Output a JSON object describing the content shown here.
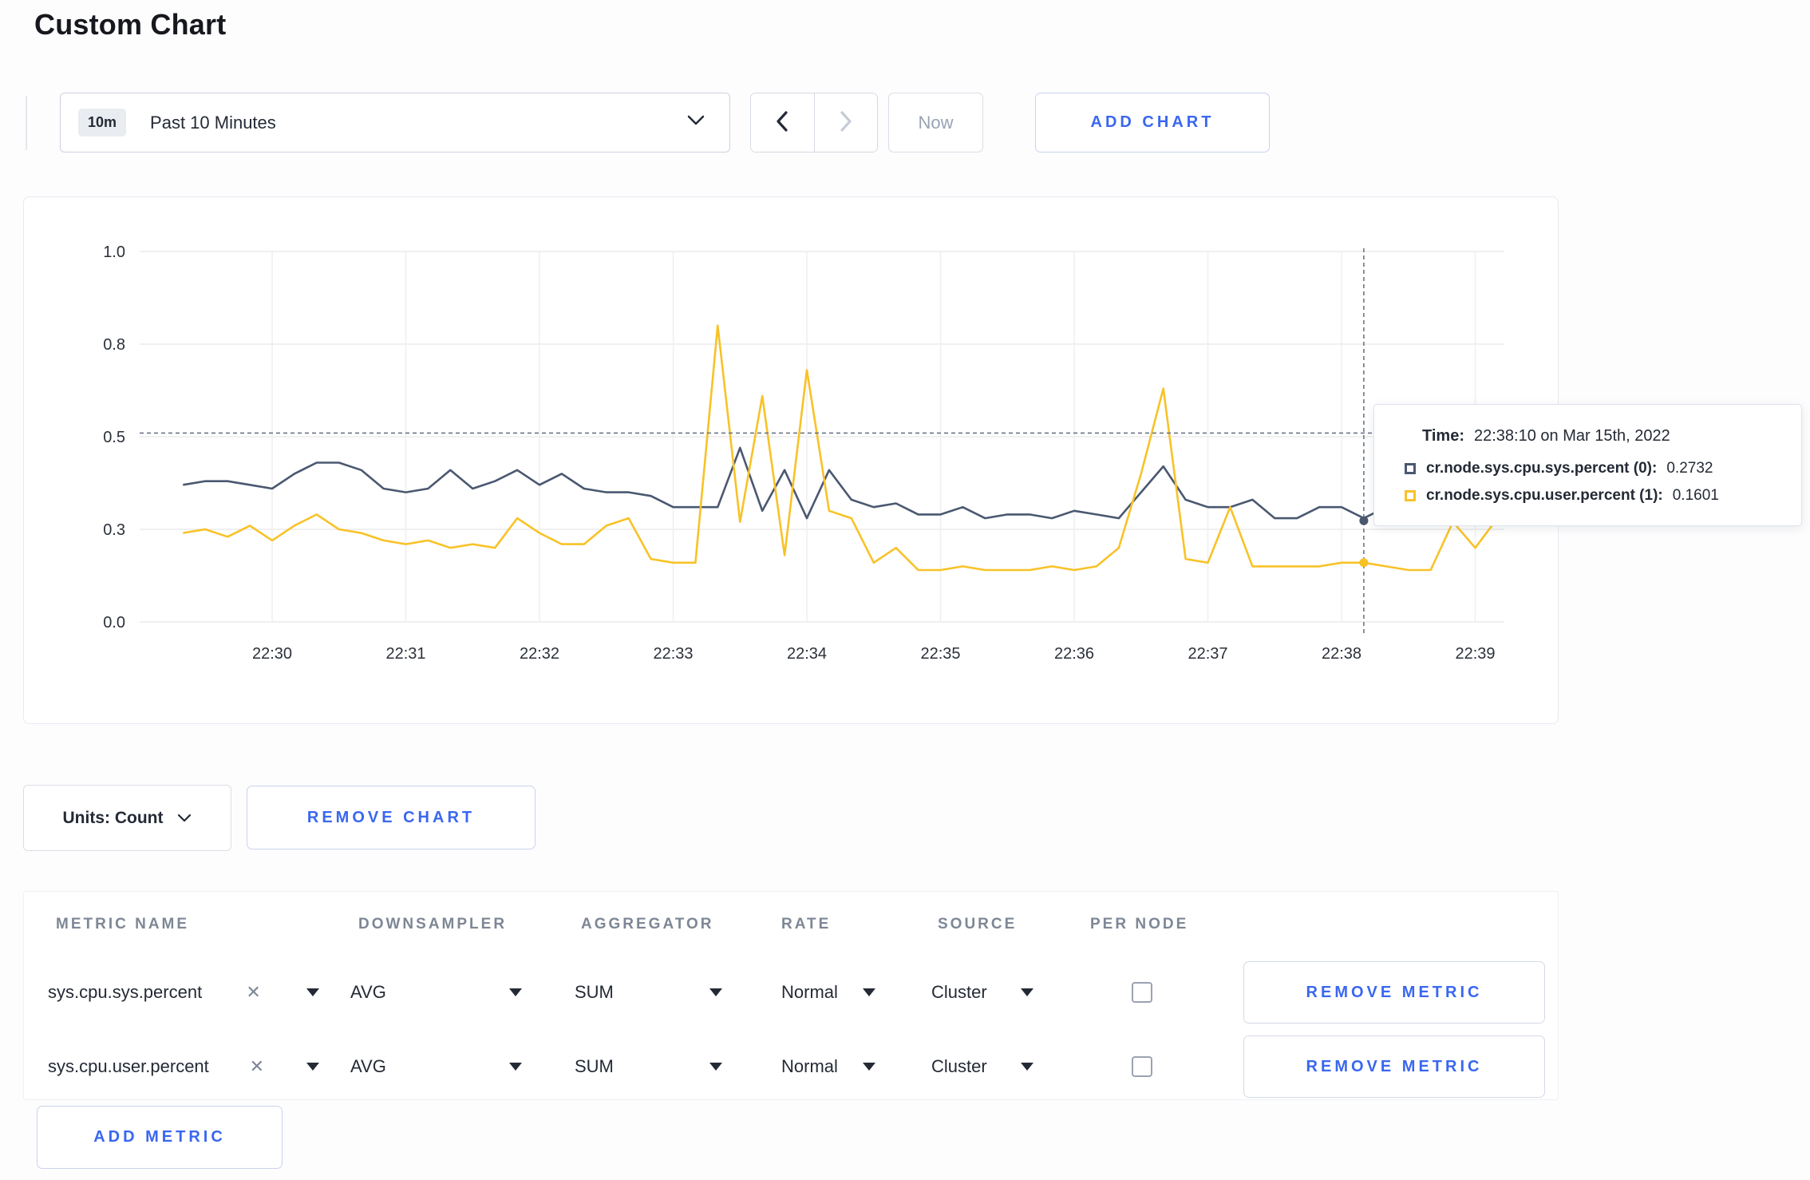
{
  "page": {
    "title": "Custom Chart"
  },
  "colors": {
    "accent_blue": "#3a67f0",
    "series_sys": "#4a5870",
    "series_user": "#f8c227",
    "gridline": "#ebebeb",
    "crosshair": "#6b7486"
  },
  "toolbar": {
    "time_badge": "10m",
    "time_label": "Past 10 Minutes",
    "now_label": "Now",
    "add_chart_label": "ADD CHART"
  },
  "chart_data": {
    "type": "line",
    "title": "",
    "ylim": [
      0,
      1
    ],
    "y_ticks": [
      {
        "value": 0.0,
        "label": "0.0"
      },
      {
        "value": 0.25,
        "label": "0.3"
      },
      {
        "value": 0.5,
        "label": "0.5"
      },
      {
        "value": 0.75,
        "label": "0.8"
      },
      {
        "value": 1.0,
        "label": "1.0"
      }
    ],
    "x_ticks": [
      "22:30",
      "22:31",
      "22:32",
      "22:33",
      "22:34",
      "22:35",
      "22:36",
      "22:37",
      "22:38",
      "22:39"
    ],
    "x_start_offset_min": -0.6667,
    "x_step_min": 0.16667,
    "series": [
      {
        "name": "cr.node.sys.cpu.sys.percent",
        "color": "#4a5870",
        "values": [
          0.37,
          0.38,
          0.38,
          0.37,
          0.36,
          0.4,
          0.43,
          0.43,
          0.41,
          0.36,
          0.35,
          0.36,
          0.41,
          0.36,
          0.38,
          0.41,
          0.37,
          0.4,
          0.36,
          0.35,
          0.35,
          0.34,
          0.31,
          0.31,
          0.31,
          0.47,
          0.3,
          0.41,
          0.28,
          0.41,
          0.33,
          0.31,
          0.32,
          0.29,
          0.29,
          0.31,
          0.28,
          0.29,
          0.29,
          0.28,
          0.3,
          0.29,
          0.28,
          0.35,
          0.42,
          0.33,
          0.31,
          0.31,
          0.33,
          0.28,
          0.28,
          0.31,
          0.31,
          0.28,
          0.31,
          0.3,
          0.31,
          0.3,
          0.31,
          0.27
        ]
      },
      {
        "name": "cr.node.sys.cpu.user.percent",
        "color": "#f8c227",
        "values": [
          0.24,
          0.25,
          0.23,
          0.26,
          0.22,
          0.26,
          0.29,
          0.25,
          0.24,
          0.22,
          0.21,
          0.22,
          0.2,
          0.21,
          0.2,
          0.28,
          0.24,
          0.21,
          0.21,
          0.26,
          0.28,
          0.17,
          0.16,
          0.16,
          0.8,
          0.27,
          0.61,
          0.18,
          0.68,
          0.3,
          0.28,
          0.16,
          0.2,
          0.14,
          0.14,
          0.15,
          0.14,
          0.14,
          0.14,
          0.15,
          0.14,
          0.15,
          0.2,
          0.4,
          0.63,
          0.17,
          0.16,
          0.31,
          0.15,
          0.15,
          0.15,
          0.15,
          0.16,
          0.16,
          0.15,
          0.14,
          0.14,
          0.27,
          0.2,
          0.28
        ]
      }
    ],
    "crosshair": {
      "time_offset_min": 8.1667,
      "hline_value": 0.51,
      "point_values": [
        0.2732,
        0.1601
      ]
    }
  },
  "tooltip": {
    "time_label": "Time:",
    "time_value": "22:38:10 on Mar 15th, 2022",
    "rows": [
      {
        "name": "cr.node.sys.cpu.sys.percent (0):",
        "value": "0.2732",
        "color": "#4a5870"
      },
      {
        "name": "cr.node.sys.cpu.user.percent (1):",
        "value": "0.1601",
        "color": "#f8c227"
      }
    ]
  },
  "chart_controls": {
    "units_label": "Units: Count",
    "remove_chart_label": "REMOVE CHART"
  },
  "metrics_table": {
    "headers": [
      "METRIC NAME",
      "DOWNSAMPLER",
      "AGGREGATOR",
      "RATE",
      "SOURCE",
      "PER NODE"
    ],
    "clear_icon": "✕",
    "rows": [
      {
        "metric": "sys.cpu.sys.percent",
        "downsampler": "AVG",
        "aggregator": "SUM",
        "rate": "Normal",
        "source": "Cluster",
        "per_node": false,
        "remove_label": "REMOVE METRIC"
      },
      {
        "metric": "sys.cpu.user.percent",
        "downsampler": "AVG",
        "aggregator": "SUM",
        "rate": "Normal",
        "source": "Cluster",
        "per_node": false,
        "remove_label": "REMOVE METRIC"
      }
    ],
    "add_metric_label": "ADD METRIC"
  }
}
